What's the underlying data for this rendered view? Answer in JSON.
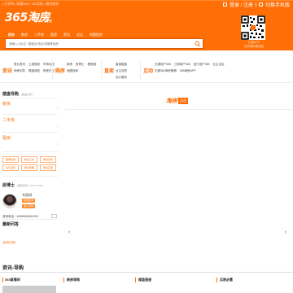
{
  "header": {
    "utility_text": "| 分享到 | 收藏365 | 365导航 | 微信服务",
    "user_links": {
      "login": "登录 / 注册",
      "switch_mobile": "切换手机版"
    },
    "logo_text": "365淘房",
    "city": "[无锡]",
    "nav": [
      "综合",
      "新房",
      "二手房",
      "租房",
      "资讯",
      "论坛",
      "地图找房"
    ],
    "search_placeholder": "请输入小区名 / 楼盘名/地名/商圈等找房",
    "qr_caption": [
      "扫描APP",
      "手机淘房更轻松"
    ]
  },
  "categories": [
    {
      "head": "资讯",
      "links": [
        "房价资讯",
        "土地规划",
        "市场动态",
        "淘房问答",
        "楼盘调查",
        "购房日记"
      ]
    },
    {
      "head": "购房",
      "links": [
        "新房",
        "房博士",
        "看房团",
        "地图找房"
      ]
    },
    {
      "head": "直卖",
      "links": [
        "直销楼盘",
        "业主自售",
        "设计服务"
      ]
    },
    {
      "head": "互动",
      "links": [
        "无锡地产365",
        "江阴地产365",
        "宜兴地产365",
        "业主论坛",
        "无锡365淘房微博",
        "365淘房APP"
      ]
    }
  ],
  "sidebar": {
    "title": "楼盘导购",
    "title_sub": "(楼盘点评)",
    "sections": [
      "新房",
      "二手房",
      "租房"
    ],
    "tags": [
      "团购优惠",
      "购房工具",
      "购房贷款",
      "房价走势",
      "看房攻略",
      "购房直选"
    ],
    "expert": {
      "title": "房博士",
      "subtitle": "(服务时间：8:00-17:00)",
      "name": "韦丽琪",
      "btn1": "在线咨询",
      "btn2": "进入问答",
      "phone": "咨询电话：4008906365-504"
    },
    "latest_qa": "最新问答",
    "more": "[咨询问答]"
  },
  "banner": {
    "logo_main": "淘房",
    "logo_tag": "点击"
  },
  "news": {
    "title": "资讯-导购",
    "columns": [
      "365直播间",
      "新房导购",
      "楼盘速递",
      "买房必看"
    ]
  }
}
